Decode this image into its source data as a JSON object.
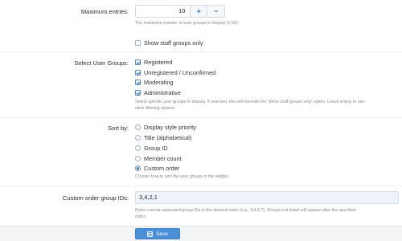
{
  "max_entries": {
    "label": "Maximum entries:",
    "value": "10",
    "increment_icon": "+",
    "decrement_icon": "−",
    "hint": "The maximum number of user groups to display (1-50)."
  },
  "staff_only": {
    "label": "Show staff groups only",
    "checked": false
  },
  "user_groups": {
    "label": "Select User Groups:",
    "options": [
      {
        "label": "Registered",
        "checked": true
      },
      {
        "label": "Unregistered / Unconfirmed",
        "checked": true
      },
      {
        "label": "Moderating",
        "checked": true
      },
      {
        "label": "Administrative",
        "checked": true
      }
    ],
    "hint_line1": "Select specific user groups to display. If selected, this will override the 'Show staff groups only' option. Leave empty to use",
    "hint_line2": "other filtering options."
  },
  "sort_by": {
    "label": "Sort by:",
    "options": [
      {
        "label": "Display style priority",
        "checked": false
      },
      {
        "label": "Title (alphabetical)",
        "checked": false
      },
      {
        "label": "Group ID",
        "checked": false
      },
      {
        "label": "Member count",
        "checked": false
      },
      {
        "label": "Custom order",
        "checked": true
      }
    ],
    "hint": "Choose how to sort the user groups in the widget."
  },
  "custom_order": {
    "label": "Custom order group IDs:",
    "value": "3,4,2,1",
    "hint_line1": "Enter comma-separated group IDs in the desired order (e.g., 3,4,5,7). Groups not listed will appear after the specified",
    "hint_line2": "order."
  },
  "footer": {
    "save_label": "Save",
    "save_icon": "floppy-disk-icon"
  }
}
